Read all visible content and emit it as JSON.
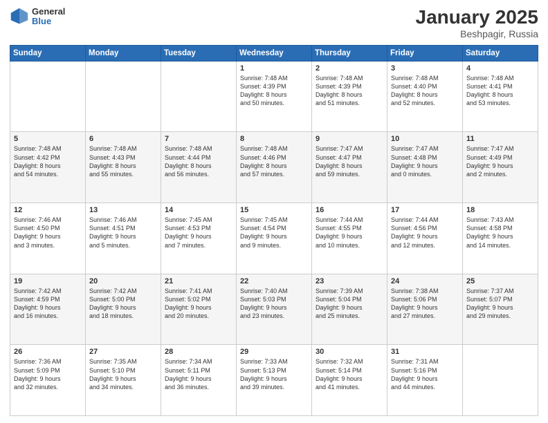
{
  "header": {
    "logo_general": "General",
    "logo_blue": "Blue",
    "title": "January 2025",
    "location": "Beshpagir, Russia"
  },
  "days_of_week": [
    "Sunday",
    "Monday",
    "Tuesday",
    "Wednesday",
    "Thursday",
    "Friday",
    "Saturday"
  ],
  "weeks": [
    [
      {
        "day": "",
        "content": ""
      },
      {
        "day": "",
        "content": ""
      },
      {
        "day": "",
        "content": ""
      },
      {
        "day": "1",
        "content": "Sunrise: 7:48 AM\nSunset: 4:39 PM\nDaylight: 8 hours\nand 50 minutes."
      },
      {
        "day": "2",
        "content": "Sunrise: 7:48 AM\nSunset: 4:39 PM\nDaylight: 8 hours\nand 51 minutes."
      },
      {
        "day": "3",
        "content": "Sunrise: 7:48 AM\nSunset: 4:40 PM\nDaylight: 8 hours\nand 52 minutes."
      },
      {
        "day": "4",
        "content": "Sunrise: 7:48 AM\nSunset: 4:41 PM\nDaylight: 8 hours\nand 53 minutes."
      }
    ],
    [
      {
        "day": "5",
        "content": "Sunrise: 7:48 AM\nSunset: 4:42 PM\nDaylight: 8 hours\nand 54 minutes."
      },
      {
        "day": "6",
        "content": "Sunrise: 7:48 AM\nSunset: 4:43 PM\nDaylight: 8 hours\nand 55 minutes."
      },
      {
        "day": "7",
        "content": "Sunrise: 7:48 AM\nSunset: 4:44 PM\nDaylight: 8 hours\nand 56 minutes."
      },
      {
        "day": "8",
        "content": "Sunrise: 7:48 AM\nSunset: 4:46 PM\nDaylight: 8 hours\nand 57 minutes."
      },
      {
        "day": "9",
        "content": "Sunrise: 7:47 AM\nSunset: 4:47 PM\nDaylight: 8 hours\nand 59 minutes."
      },
      {
        "day": "10",
        "content": "Sunrise: 7:47 AM\nSunset: 4:48 PM\nDaylight: 9 hours\nand 0 minutes."
      },
      {
        "day": "11",
        "content": "Sunrise: 7:47 AM\nSunset: 4:49 PM\nDaylight: 9 hours\nand 2 minutes."
      }
    ],
    [
      {
        "day": "12",
        "content": "Sunrise: 7:46 AM\nSunset: 4:50 PM\nDaylight: 9 hours\nand 3 minutes."
      },
      {
        "day": "13",
        "content": "Sunrise: 7:46 AM\nSunset: 4:51 PM\nDaylight: 9 hours\nand 5 minutes."
      },
      {
        "day": "14",
        "content": "Sunrise: 7:45 AM\nSunset: 4:53 PM\nDaylight: 9 hours\nand 7 minutes."
      },
      {
        "day": "15",
        "content": "Sunrise: 7:45 AM\nSunset: 4:54 PM\nDaylight: 9 hours\nand 9 minutes."
      },
      {
        "day": "16",
        "content": "Sunrise: 7:44 AM\nSunset: 4:55 PM\nDaylight: 9 hours\nand 10 minutes."
      },
      {
        "day": "17",
        "content": "Sunrise: 7:44 AM\nSunset: 4:56 PM\nDaylight: 9 hours\nand 12 minutes."
      },
      {
        "day": "18",
        "content": "Sunrise: 7:43 AM\nSunset: 4:58 PM\nDaylight: 9 hours\nand 14 minutes."
      }
    ],
    [
      {
        "day": "19",
        "content": "Sunrise: 7:42 AM\nSunset: 4:59 PM\nDaylight: 9 hours\nand 16 minutes."
      },
      {
        "day": "20",
        "content": "Sunrise: 7:42 AM\nSunset: 5:00 PM\nDaylight: 9 hours\nand 18 minutes."
      },
      {
        "day": "21",
        "content": "Sunrise: 7:41 AM\nSunset: 5:02 PM\nDaylight: 9 hours\nand 20 minutes."
      },
      {
        "day": "22",
        "content": "Sunrise: 7:40 AM\nSunset: 5:03 PM\nDaylight: 9 hours\nand 23 minutes."
      },
      {
        "day": "23",
        "content": "Sunrise: 7:39 AM\nSunset: 5:04 PM\nDaylight: 9 hours\nand 25 minutes."
      },
      {
        "day": "24",
        "content": "Sunrise: 7:38 AM\nSunset: 5:06 PM\nDaylight: 9 hours\nand 27 minutes."
      },
      {
        "day": "25",
        "content": "Sunrise: 7:37 AM\nSunset: 5:07 PM\nDaylight: 9 hours\nand 29 minutes."
      }
    ],
    [
      {
        "day": "26",
        "content": "Sunrise: 7:36 AM\nSunset: 5:09 PM\nDaylight: 9 hours\nand 32 minutes."
      },
      {
        "day": "27",
        "content": "Sunrise: 7:35 AM\nSunset: 5:10 PM\nDaylight: 9 hours\nand 34 minutes."
      },
      {
        "day": "28",
        "content": "Sunrise: 7:34 AM\nSunset: 5:11 PM\nDaylight: 9 hours\nand 36 minutes."
      },
      {
        "day": "29",
        "content": "Sunrise: 7:33 AM\nSunset: 5:13 PM\nDaylight: 9 hours\nand 39 minutes."
      },
      {
        "day": "30",
        "content": "Sunrise: 7:32 AM\nSunset: 5:14 PM\nDaylight: 9 hours\nand 41 minutes."
      },
      {
        "day": "31",
        "content": "Sunrise: 7:31 AM\nSunset: 5:16 PM\nDaylight: 9 hours\nand 44 minutes."
      },
      {
        "day": "",
        "content": ""
      }
    ]
  ]
}
